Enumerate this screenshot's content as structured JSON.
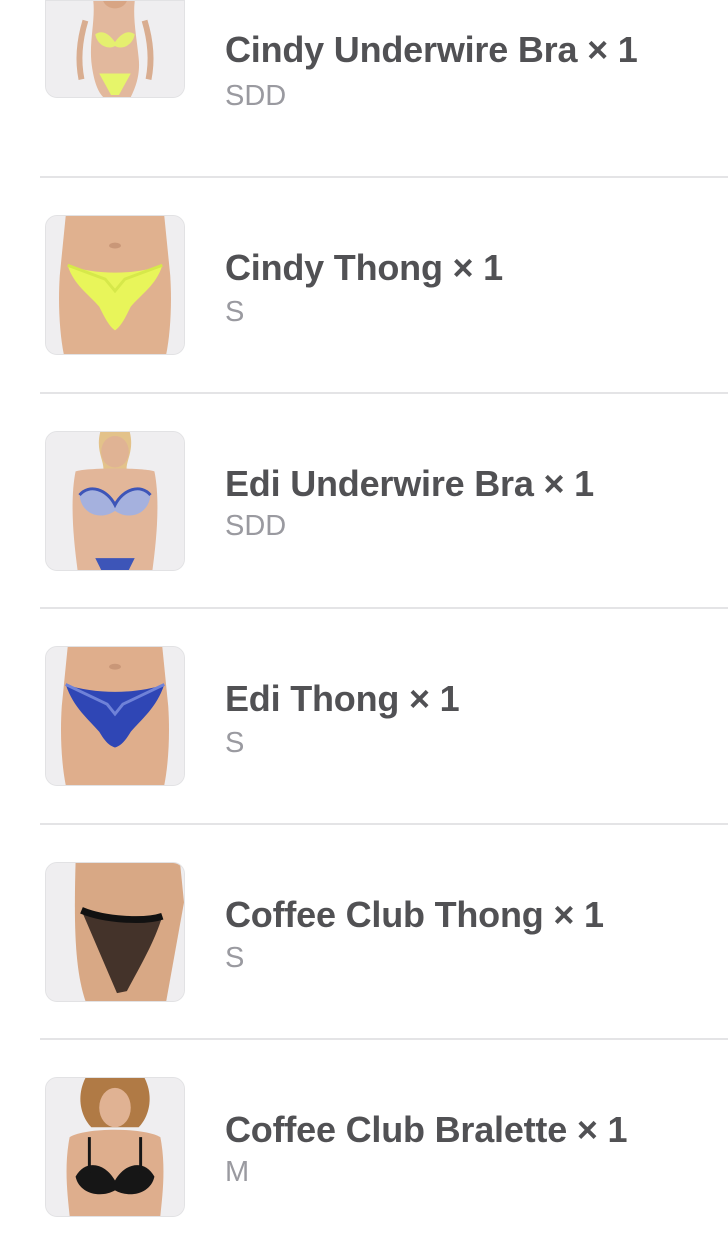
{
  "order_items": [
    {
      "title": "Cindy Underwire Bra × 1",
      "size": "SDD",
      "image_icon": "product-photo-cindy-underwire-bra",
      "garment_color": "#e6f56a"
    },
    {
      "title": "Cindy Thong × 1",
      "size": "S",
      "image_icon": "product-photo-cindy-thong",
      "garment_color": "#e8f55a"
    },
    {
      "title": "Edi Underwire Bra × 1",
      "size": "SDD",
      "image_icon": "product-photo-edi-underwire-bra",
      "garment_color": "#3d55b8"
    },
    {
      "title": "Edi Thong × 1",
      "size": "S",
      "image_icon": "product-photo-edi-thong",
      "garment_color": "#2f46b5"
    },
    {
      "title": "Coffee Club Thong × 1",
      "size": "S",
      "image_icon": "product-photo-coffee-club-thong",
      "garment_color": "#1b1b1b"
    },
    {
      "title": "Coffee Club Bralette × 1",
      "size": "M",
      "image_icon": "product-photo-coffee-club-bralette",
      "garment_color": "#161616"
    }
  ]
}
